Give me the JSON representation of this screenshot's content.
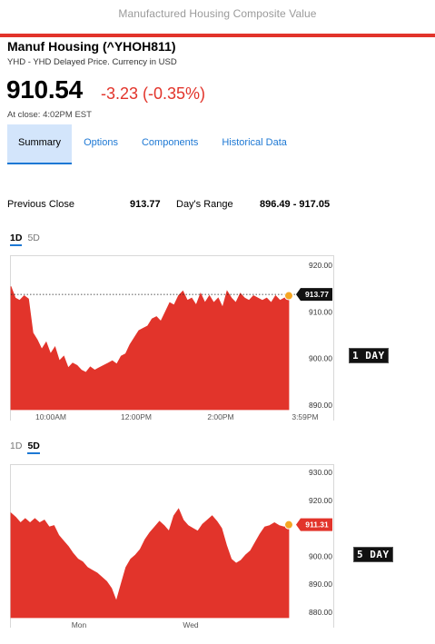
{
  "banner": {
    "text": "Manufactured Housing Composite Value"
  },
  "quote": {
    "name": "Manuf Housing (^YHOH811)",
    "source": "YHD - YHD Delayed Price. Currency in USD",
    "price": "910.54",
    "change": "-3.23 (-0.35%)",
    "close_time": "At close: 4:02PM EST"
  },
  "tabs": [
    {
      "label": "Summary",
      "active": true
    },
    {
      "label": "Options",
      "active": false
    },
    {
      "label": "Components",
      "active": false
    },
    {
      "label": "Historical Data",
      "active": false
    }
  ],
  "stats": {
    "prev_close_label": "Previous Close",
    "prev_close_value": "913.77",
    "days_range_label": "Day's Range",
    "days_range_value": "896.49 - 917.05"
  },
  "colors": {
    "accent_red": "#e2342b",
    "link_blue": "#1d78d4",
    "tab_active_bg": "#d3e5fb",
    "marker_orange": "#f5a623"
  },
  "chart_data": [
    {
      "type": "area",
      "range_options": [
        {
          "label": "1D",
          "selected": true
        },
        {
          "label": "5D",
          "selected": false
        }
      ],
      "ylim": [
        889,
        922
      ],
      "y_ticks": [
        "920.00",
        "910.00",
        "900.00",
        "890.00"
      ],
      "x_ticks": [
        "10:00AM",
        "12:00PM",
        "2:00PM",
        "3:59PM"
      ],
      "reference_label": "913.77",
      "reference_value": 913.77,
      "side_tag": "1 DAY",
      "values": [
        915.5,
        913.0,
        912.5,
        913.5,
        912.8,
        905.5,
        904.0,
        902.0,
        903.5,
        901.0,
        902.5,
        899.5,
        900.5,
        898.0,
        899.0,
        898.5,
        897.5,
        897.0,
        898.2,
        897.5,
        898.0,
        898.5,
        899.0,
        899.5,
        898.8,
        900.5,
        901.0,
        903.0,
        904.5,
        906.0,
        906.5,
        907.0,
        908.5,
        909.0,
        908.0,
        910.0,
        912.0,
        911.5,
        913.5,
        914.5,
        912.5,
        913.0,
        911.5,
        914.0,
        912.0,
        913.5,
        912.0,
        913.0,
        911.0,
        914.5,
        913.0,
        912.0,
        914.0,
        913.0,
        912.5,
        913.5,
        913.0,
        912.5,
        913.0,
        912.0,
        913.5,
        912.5,
        913.0,
        913.5
      ]
    },
    {
      "type": "area",
      "range_options": [
        {
          "label": "1D",
          "selected": false
        },
        {
          "label": "5D",
          "selected": true
        }
      ],
      "ylim": [
        878,
        933
      ],
      "y_ticks": [
        "930.00",
        "920.00",
        "910.00",
        "900.00",
        "890.00",
        "880.00"
      ],
      "x_ticks": [
        "Mon",
        "Wed"
      ],
      "last_label": "911.31",
      "side_tag": "5 DAY",
      "values": [
        915.5,
        914.0,
        912.0,
        913.5,
        912.0,
        913.5,
        912.0,
        913.0,
        910.5,
        911.0,
        907.5,
        905.5,
        903.5,
        901.0,
        899.0,
        898.0,
        896.0,
        895.0,
        894.0,
        892.5,
        891.0,
        888.5,
        884.0,
        890.0,
        896.0,
        899.0,
        900.5,
        902.5,
        906.0,
        908.5,
        910.5,
        912.5,
        911.0,
        909.0,
        914.5,
        917.0,
        913.0,
        911.0,
        910.0,
        909.0,
        911.5,
        913.0,
        914.5,
        912.5,
        910.0,
        904.0,
        899.0,
        897.5,
        898.5,
        900.5,
        902.0,
        905.0,
        908.0,
        910.5,
        911.0,
        912.0,
        911.0,
        910.5,
        911.3
      ]
    }
  ]
}
